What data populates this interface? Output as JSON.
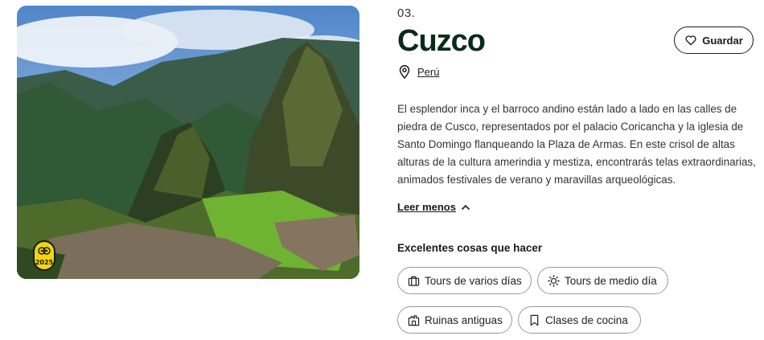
{
  "destination": {
    "index": "03.",
    "title": "Cuzco",
    "country": "Perú",
    "description": "El esplendor inca y el barroco andino están lado a lado en las calles de piedra de Cusco, representados por el palacio Coricancha y la iglesia de Santo Domingo flanqueando la Plaza de Armas. En este crisol de altas alturas de la cultura amerindia y mestiza, encontrarás telas extraordinarias, animados festivales de verano y maravillas arqueológicas.",
    "read_less_label": "Leer menos",
    "save_label": "Guardar",
    "award_year": "2025"
  },
  "things_to_do": {
    "title": "Excelentes cosas que hacer",
    "chips": [
      {
        "label": "Tours de varios días",
        "icon": "briefcase-icon"
      },
      {
        "label": "Tours de medio día",
        "icon": "sun-icon"
      },
      {
        "label": "Ruinas antiguas",
        "icon": "ruins-icon"
      },
      {
        "label": "Clases de cocina",
        "icon": "bookmark-icon"
      }
    ]
  },
  "colors": {
    "title": "#0b2a1e",
    "award_badge": "#f2d60a",
    "chip_border": "#9a9a9a"
  }
}
